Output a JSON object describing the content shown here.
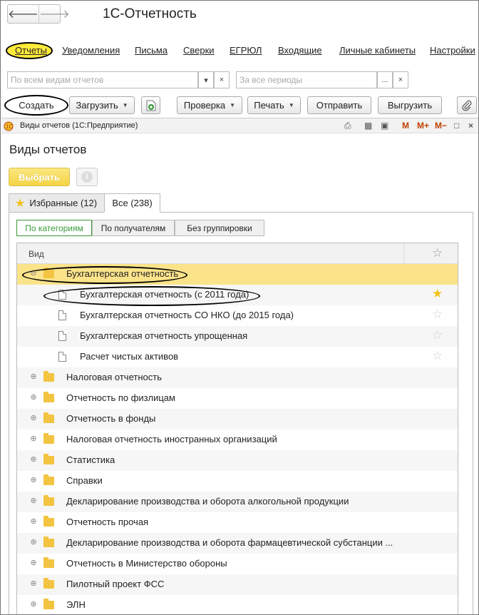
{
  "window": {
    "title": "1С-Отчетность",
    "back_glyph": "🡐",
    "forward_glyph": "🡒"
  },
  "menu": [
    {
      "label": "Отчеты",
      "name": "menu-reports",
      "active": true
    },
    {
      "label": "Уведомления",
      "name": "menu-notifications"
    },
    {
      "label": "Письма",
      "name": "menu-letters"
    },
    {
      "label": "Сверки",
      "name": "menu-reconciliations"
    },
    {
      "label": "ЕГРЮЛ",
      "name": "menu-egrul"
    },
    {
      "label": "Входящие",
      "name": "menu-incoming"
    },
    {
      "label": "Личные кабинеты",
      "name": "menu-personal-cabinets"
    },
    {
      "label": "Настройки",
      "name": "menu-settings"
    }
  ],
  "filters": {
    "report_type_placeholder": "По всем видам отчетов",
    "period_placeholder": "За все периоды"
  },
  "toolbar": {
    "create": "Создать",
    "upload": "Загрузить",
    "check": "Проверка",
    "print": "Печать",
    "send": "Отправить",
    "export": "Выгрузить"
  },
  "dialog": {
    "window_title": "Виды отчетов  (1С:Предприятие)",
    "heading": "Виды отчетов",
    "choose_button": "Выбрать",
    "info_glyph": "i",
    "tools": [
      "M",
      "M+",
      "M−"
    ],
    "tabs": {
      "favorites": "Избранные (12)",
      "all": "Все (238)"
    },
    "grouping": {
      "by_category": "По категориям",
      "by_recipient": "По получателям",
      "no_grouping": "Без группировки"
    },
    "table": {
      "column_name": "Вид",
      "rows": [
        {
          "label": "Бухгалтерская отчетность",
          "kind": "folder",
          "expanded": true,
          "selected": true
        },
        {
          "label": "Бухгалтерская отчетность (с 2011 года)",
          "kind": "doc",
          "favorite": true
        },
        {
          "label": "Бухгалтерская отчетность СО НКО (до 2015 года)",
          "kind": "doc",
          "favorite": false
        },
        {
          "label": "Бухгалтерская отчетность упрощенная",
          "kind": "doc",
          "favorite": false
        },
        {
          "label": "Расчет чистых активов",
          "kind": "doc",
          "favorite": false
        },
        {
          "label": "Налоговая отчетность",
          "kind": "folder"
        },
        {
          "label": "Отчетность по физлицам",
          "kind": "folder"
        },
        {
          "label": "Отчетность в фонды",
          "kind": "folder"
        },
        {
          "label": "Налоговая отчетность иностранных организаций",
          "kind": "folder"
        },
        {
          "label": "Статистика",
          "kind": "folder"
        },
        {
          "label": "Справки",
          "kind": "folder"
        },
        {
          "label": "Декларирование производства и оборота алкогольной продукции",
          "kind": "folder"
        },
        {
          "label": "Отчетность прочая",
          "kind": "folder"
        },
        {
          "label": "Декларирование производства и оборота фармацевтической субстанции ...",
          "kind": "folder"
        },
        {
          "label": "Отчетность в Министерство обороны",
          "kind": "folder"
        },
        {
          "label": "Пилотный проект ФСС",
          "kind": "folder"
        },
        {
          "label": "ЭЛН",
          "kind": "folder"
        }
      ]
    }
  },
  "colors": {
    "selection": "#fbe38a",
    "accent_green": "#3a9a3a",
    "star_on": "#f1c21b",
    "folder": "#f3c441",
    "highlight": "#ffeb3b"
  }
}
